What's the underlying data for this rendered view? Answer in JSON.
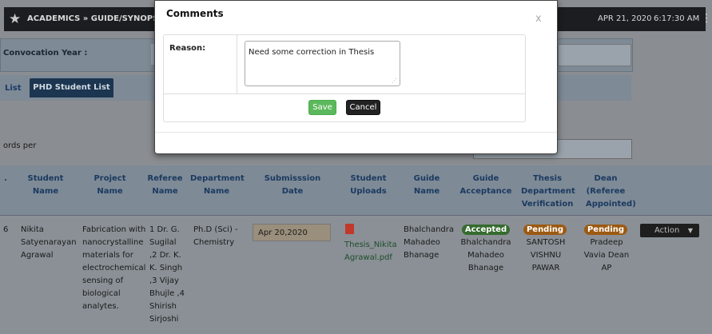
{
  "header": {
    "breadcrumb": "ACADEMICS » GUIDE/SYNOPSIS",
    "date": "APR 21, 2020",
    "time": "6:17:30 AM",
    "star_icon": "star-icon",
    "menu_icon": "kebab-menu-icon"
  },
  "filter": {
    "label": "Convocation Year :"
  },
  "tabs": [
    {
      "label": "List"
    },
    {
      "label": "PHD Student List"
    }
  ],
  "records_label": "ords per",
  "table": {
    "columns": [
      "Student Name",
      "Project Name",
      "Referee Name",
      "Department Name",
      "Submisssion Date",
      "Student Uploads",
      "Guide Name",
      "Guide Acceptance",
      "Thesis Department Verification",
      "Dean (Referee Appointed)"
    ],
    "row": {
      "index": "6",
      "student_name": "Nikita Satyenarayan Agrawal",
      "project_name": "Fabrication with nanocrystalline materials for electrochemical sensing of biological analytes.",
      "referee_name": "1 Dr. G. Sugilal ,2 Dr. K. K. Singh ,3 Vijay Bhujle ,4 Shirish Sirjoshi",
      "department": "Ph.D (Sci) - Chemistry",
      "submission_date": "Apr 20,2020",
      "upload_file": "Thesis_Nikita Agrawal.pdf",
      "guide_name": "Bhalchandra Mahadeo Bhanage",
      "guide_acceptance_status": "Accepted",
      "guide_acceptance_name": "Bhalchandra Mahadeo Bhanage",
      "thesis_status": "Pending",
      "thesis_name": "SANTOSH VISHNU PAWAR",
      "dean_status": "Pending",
      "dean_name": "Pradeep Vavia Dean AP",
      "action_label": "Action"
    }
  },
  "modal": {
    "title": "Comments",
    "close": "x",
    "reason_label": "Reason:",
    "reason_value": "Need some correction in Thesis",
    "save_label": "Save",
    "cancel_label": "Cancel"
  },
  "colors": {
    "save": "#5cb85c",
    "cancel": "#222222",
    "accepted": "#356b2f",
    "pending": "#9c5a12"
  }
}
